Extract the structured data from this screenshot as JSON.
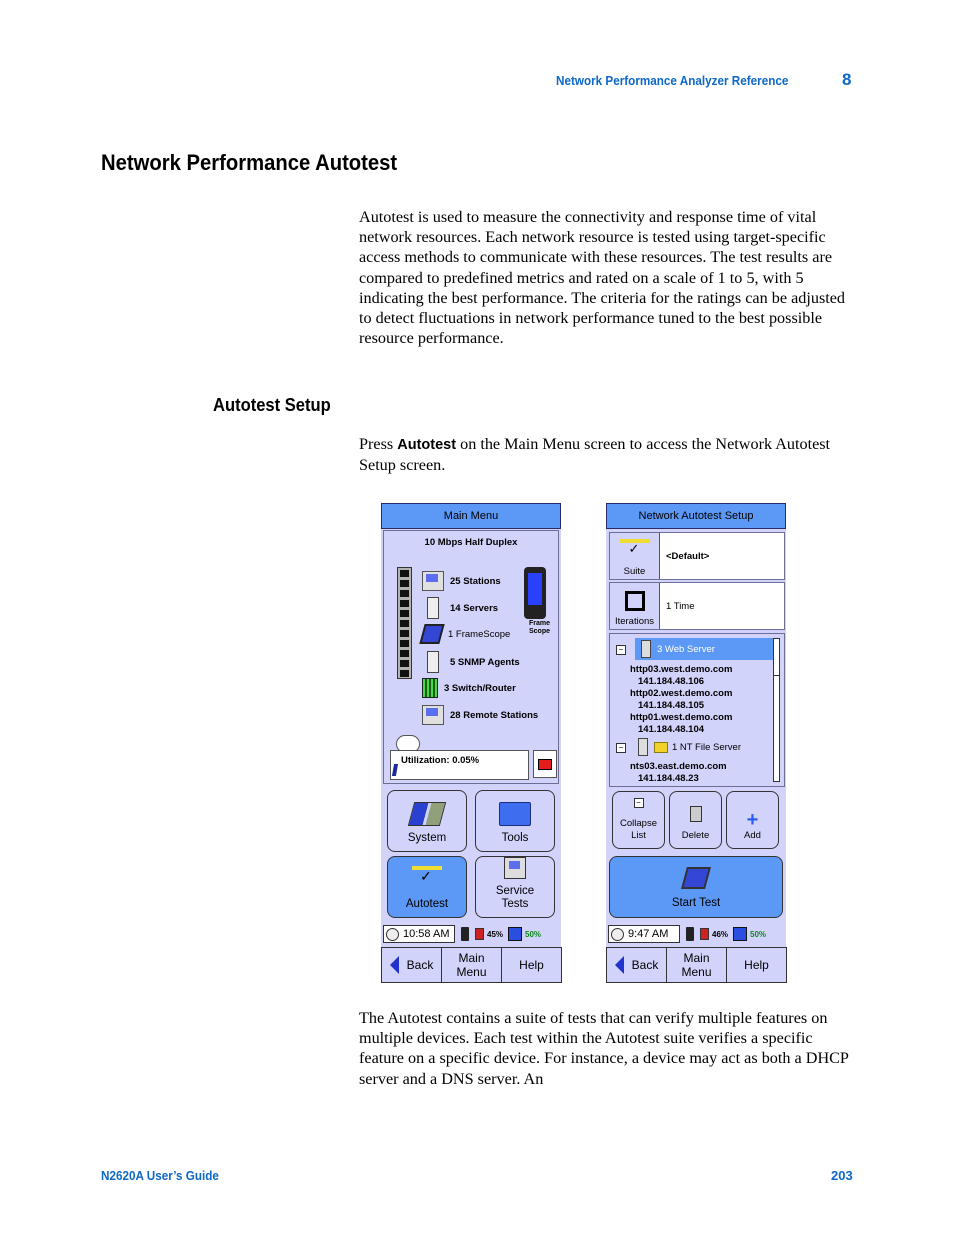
{
  "header": {
    "running_title": "Network Performance Analyzer Reference",
    "chapter": "8"
  },
  "section_title": "Network Performance Autotest",
  "intro_paragraph": "Autotest is used to measure the connectivity and response time of vital network resources. Each network resource is tested using target-specific access methods to communicate with these resources. The test results are compared to predefined metrics and rated on a scale of 1 to 5, with 5 indicating the best performance. The criteria for the ratings can be adjusted to detect fluctuations in network performance tuned to the best possible resource performance.",
  "subsection_title": "Autotest Setup",
  "setup_paragraph": {
    "prefix": "Press ",
    "bold": "Autotest",
    "suffix": " on the Main Menu screen to access the Network Autotest Setup screen."
  },
  "main_menu_screen": {
    "title": "Main Menu",
    "link_speed": "10 Mbps Half Duplex",
    "devices": [
      {
        "label": "25 Stations",
        "icon": "workstation-icon"
      },
      {
        "label": "14 Servers",
        "icon": "server-icon"
      },
      {
        "label": "1 FrameScope",
        "icon": "handheld-icon"
      },
      {
        "label": "5 SNMP Agents",
        "icon": "server-icon"
      },
      {
        "label": "3 Switch/Router",
        "icon": "switch-icon"
      },
      {
        "label": "28 Remote Stations",
        "icon": "workstation-icon"
      }
    ],
    "framescope_label_1": "Frame",
    "framescope_label_2": "Scope",
    "utilization": "Utilization: 0.05%",
    "utilization_percent": 0.05,
    "buttons": {
      "system": "System",
      "tools": "Tools",
      "autotest": "Autotest",
      "service_tests_1": "Service",
      "service_tests_2": "Tests"
    },
    "status": {
      "time": "10:58 AM",
      "battery": "45%",
      "storage": "50%"
    },
    "nav": {
      "back": "Back",
      "main_menu_1": "Main",
      "main_menu_2": "Menu",
      "help": "Help"
    }
  },
  "autotest_setup_screen": {
    "title": "Network Autotest Setup",
    "suite_label": "Suite",
    "suite_value": "<Default>",
    "iterations_label": "Iterations",
    "iterations_value": "1 Time",
    "tree": {
      "groups": [
        {
          "label": "3 Web Server",
          "selected": true,
          "hosts": [
            {
              "name": "http03.west.demo.com",
              "ip": "141.184.48.106"
            },
            {
              "name": "http02.west.demo.com",
              "ip": "141.184.48.105"
            },
            {
              "name": "http01.west.demo.com",
              "ip": "141.184.48.104"
            }
          ]
        },
        {
          "label": "1 NT File Server",
          "selected": false,
          "hosts": [
            {
              "name": "nts03.east.demo.com",
              "ip": "141.184.48.23"
            }
          ]
        }
      ]
    },
    "buttons": {
      "collapse_1": "Collapse",
      "collapse_2": "List",
      "delete": "Delete",
      "add": "Add",
      "start_test": "Start Test"
    },
    "status": {
      "time": "9:47 AM",
      "battery": "46%",
      "storage": "50%"
    },
    "nav": {
      "back": "Back",
      "main_menu_1": "Main",
      "main_menu_2": "Menu",
      "help": "Help"
    }
  },
  "closing_paragraph": "The Autotest contains a suite of tests that can verify multiple features on multiple devices. Each test within the Autotest suite verifies a specific feature on a specific device. For instance, a device may act as both a DHCP server and a DNS server. An",
  "footer": {
    "guide_title": "N2620A User’s Guide",
    "page_number": "203"
  }
}
